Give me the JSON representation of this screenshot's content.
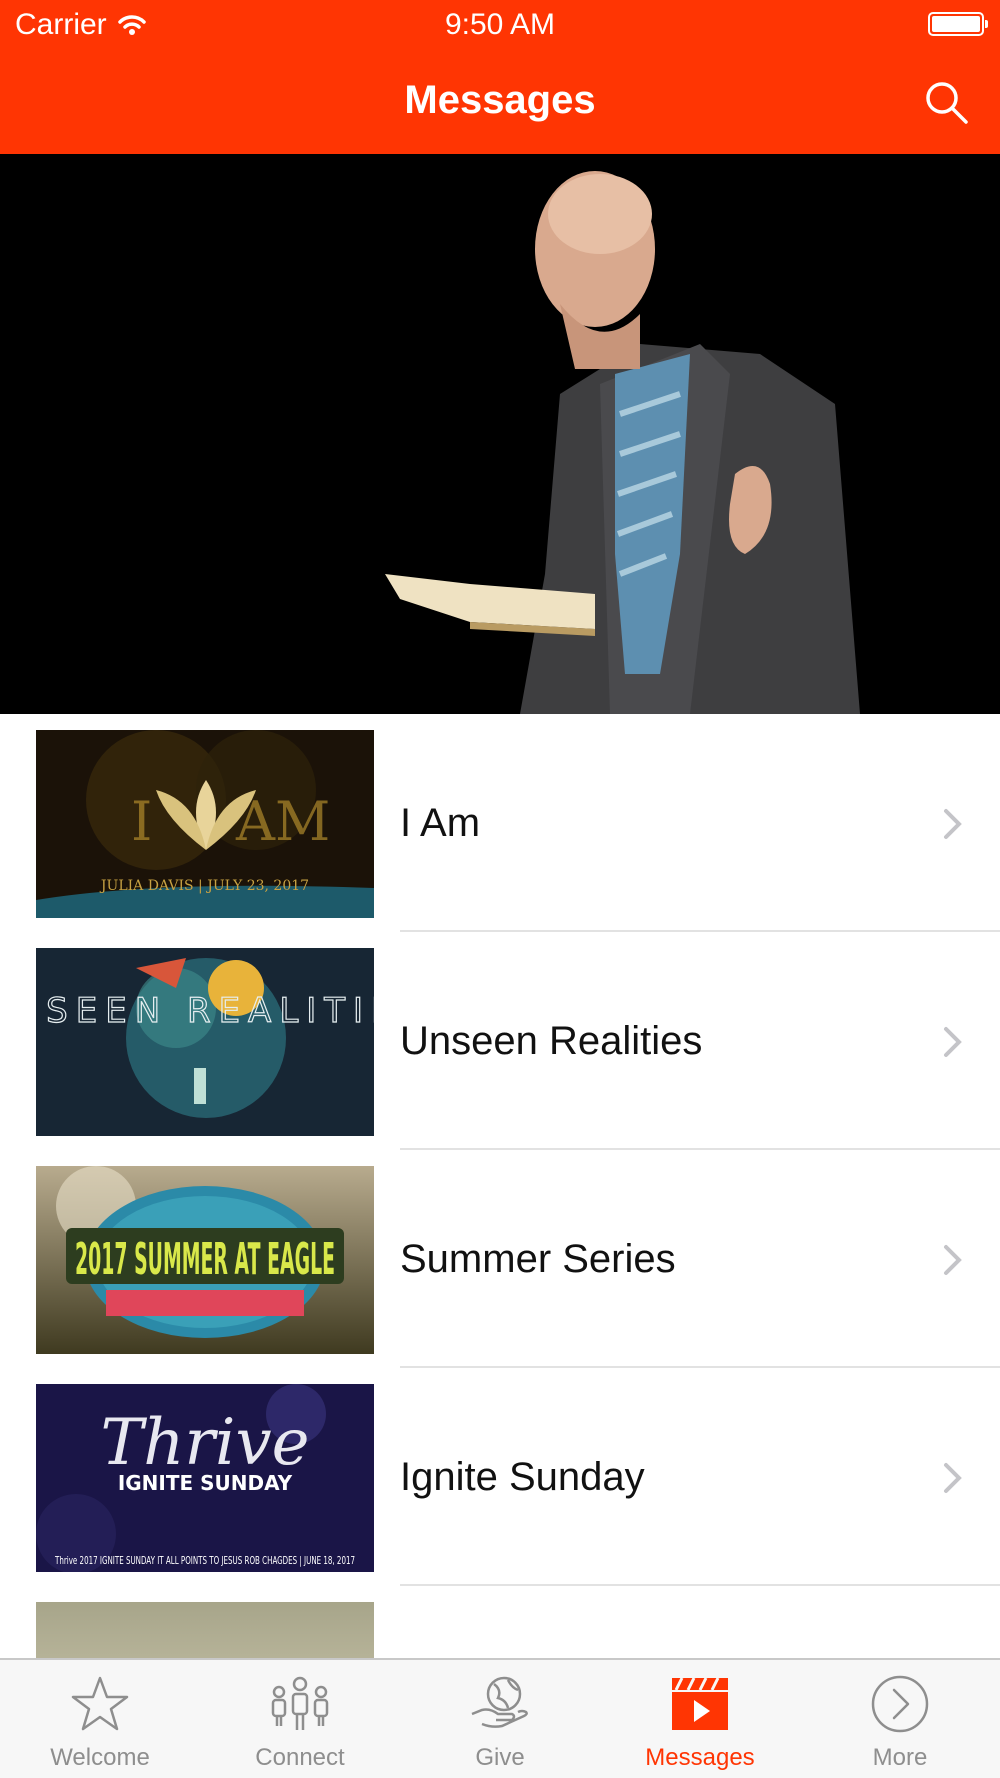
{
  "status_bar": {
    "carrier": "Carrier",
    "time": "9:50 AM"
  },
  "nav": {
    "title": "Messages",
    "search_icon": "search-icon"
  },
  "colors": {
    "accent": "#ff3503",
    "tab_inactive": "#8e8e8e",
    "separator": "#e2e2e2"
  },
  "hero": {
    "image": "speaker-holding-bible-photo"
  },
  "messages": [
    {
      "title": "I Am",
      "thumbnail_text": "JULIA DAVIS | JULY 23, 2017"
    },
    {
      "title": "Unseen Realities",
      "thumbnail_text": "UNSEEN REALITIES"
    },
    {
      "title": "Summer Series",
      "thumbnail_text": "2017 SUMMER AT EAGLE"
    },
    {
      "title": "Ignite Sunday",
      "thumbnail_text": "Thrive 2017 IGNITE SUNDAY IT ALL POINTS TO JESUS ROB CHAGDES | JUNE 18, 2017"
    }
  ],
  "tabs": [
    {
      "label": "Welcome",
      "icon": "star-icon",
      "active": false
    },
    {
      "label": "Connect",
      "icon": "people-icon",
      "active": false
    },
    {
      "label": "Give",
      "icon": "hand-globe-icon",
      "active": false
    },
    {
      "label": "Messages",
      "icon": "clapperboard-play-icon",
      "active": true
    },
    {
      "label": "More",
      "icon": "circle-chevron-icon",
      "active": false
    }
  ]
}
